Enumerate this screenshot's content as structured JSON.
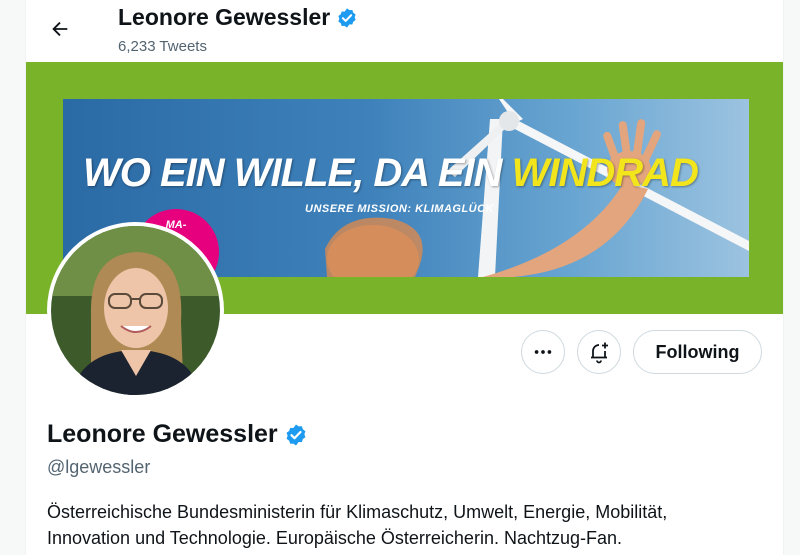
{
  "header": {
    "name": "Leonore Gewessler",
    "tweet_count": "6,233 Tweets"
  },
  "banner": {
    "headline_part1": "WO EIN WILLE, DA EIN ",
    "headline_highlight": "WINDRAD",
    "subline": "UNSERE MISSION: KLIMAGLÜCK",
    "badge_text": "MA-\nK",
    "colors": {
      "background_green": "#79b32a",
      "highlight_yellow": "#f2e51c",
      "badge_pink": "#e6007e"
    }
  },
  "actions": {
    "more_icon": "more-dots-icon",
    "notify_icon": "bell-plus-icon",
    "follow_label": "Following"
  },
  "profile": {
    "name": "Leonore Gewessler",
    "handle": "@lgewessler",
    "verified_icon": "verified-badge-icon",
    "verified_color": "#1d9bf0",
    "bio_line1": "Österreichische Bundesministerin für Klimaschutz, Umwelt, Energie, Mobilität,",
    "bio_line2": "Innovation und Technologie. Europäische Österreicherin. Nachtzug-Fan."
  }
}
